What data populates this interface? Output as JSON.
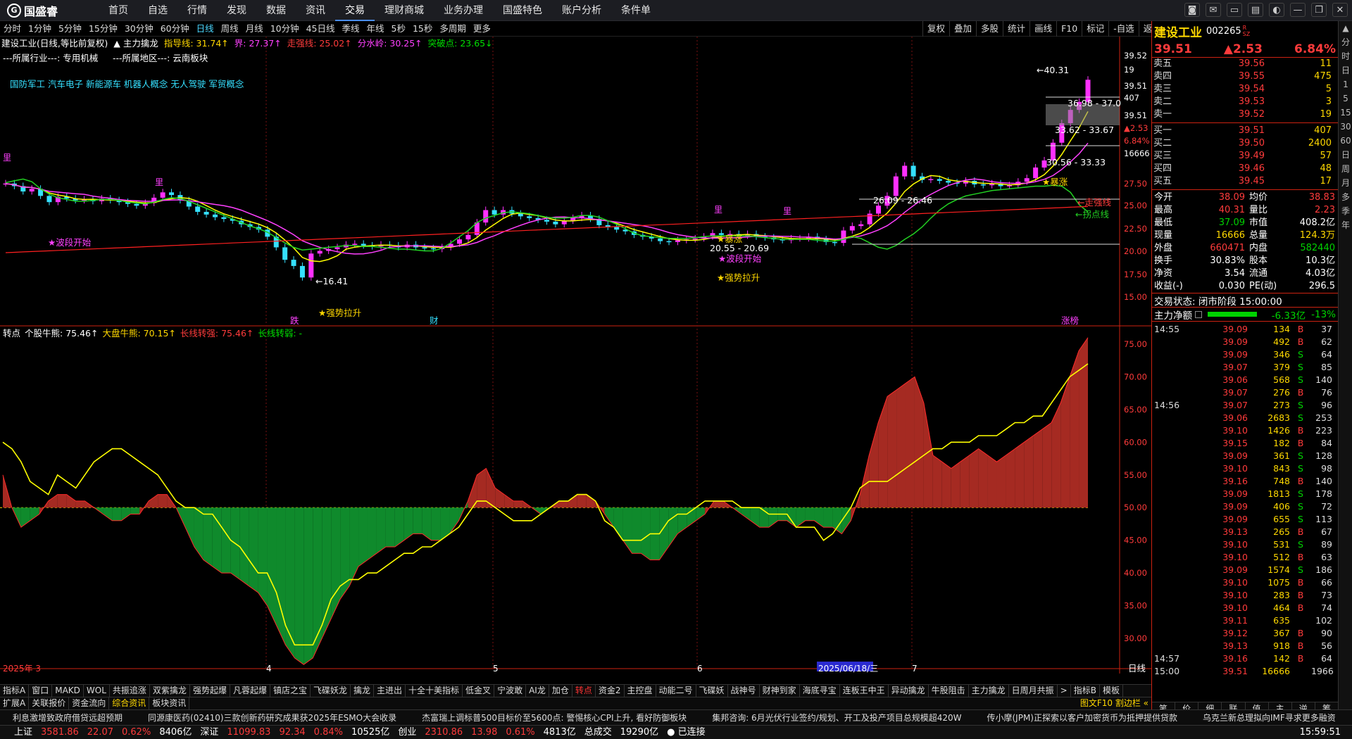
{
  "top": {
    "logo": "国盛睿",
    "menu": [
      "首页",
      "自选",
      "行情",
      "发现",
      "数据",
      "资讯",
      "交易",
      "理财商城",
      "业务办理",
      "国盛特色",
      "账户分析",
      "条件单"
    ],
    "active": 6
  },
  "periods": [
    "分时",
    "1分钟",
    "5分钟",
    "15分钟",
    "30分钟",
    "60分钟",
    "日线",
    "周线",
    "月线",
    "10分钟",
    "45日线",
    "季线",
    "年线",
    "5秒",
    "15秒",
    "多周期",
    "更多"
  ],
  "active_period": "日线",
  "tools": [
    "复权",
    "叠加",
    "多股",
    "统计",
    "画线",
    "F10",
    "标记",
    "-自选",
    "返回"
  ],
  "info": {
    "line1": [
      [
        "建设工业(日线,等比前复权)",
        "white"
      ],
      [
        "▲ 主力擒龙",
        "white"
      ],
      [
        "指导线: 31.74↑",
        "yellow"
      ],
      [
        "界: 27.37↑",
        "mag"
      ],
      [
        "走强线: 25.02↑",
        "red"
      ],
      [
        "分水岭: 30.25↑",
        "mag"
      ],
      [
        "突破点: 23.65↓",
        "green"
      ]
    ],
    "line2": "---所属行业---: 专用机械",
    "line3": "---所属地区---: 云南板块",
    "concepts": "国防军工 汽车电子 新能源车 机器人概念 无人驾驶 军贸概念"
  },
  "chart_data": {
    "type": "candlestick+indicator",
    "y_ticks": [
      "39.52",
      "19",
      "39.51",
      "407",
      "39.51",
      "▲2.53",
      "6.84%",
      "16666",
      "27.50",
      "25.00",
      "22.50",
      "20.00",
      "17.50",
      "15.00"
    ],
    "annotations": {
      "high": "←40.31",
      "low": "←16.41",
      "box1": "36.98 - 37.0",
      "box2": "33.62 - 33.67",
      "box3": "30.56 - 33.33",
      "box4": "26.09 - 26.46",
      "box5": "20.55 - 20.69",
      "lab1": "40.31",
      "bodong1": "★波段开始",
      "bodong2": "★波段开始",
      "qiang1": "★强势拉升",
      "qiang2": "★强势拉升",
      "meizhang1": "★暴涨",
      "meizhang2": "★暴涨",
      "zouqiang": "←走强线",
      "guaidian": "←拐点线",
      "die": "跌",
      "cai": "财",
      "zhangdie": "涨榜",
      "li": "里"
    },
    "ind_header": [
      [
        "转点",
        "white"
      ],
      [
        "个股牛熊: 75.46↑",
        "white"
      ],
      [
        "大盘牛熊: 70.15↑",
        "yellow"
      ],
      [
        "长线转强: 75.46↑",
        "red"
      ],
      [
        "长线转弱: -",
        "green"
      ]
    ],
    "ind_ticks": [
      "75.00",
      "70.00",
      "65.00",
      "60.00",
      "55.00",
      "50.00",
      "45.00",
      "40.00",
      "35.00",
      "30.00"
    ],
    "x_labels": [
      "2025年 3",
      "4",
      "5",
      "6",
      "2025/06/18/三",
      "7"
    ],
    "x_corner": "日线",
    "ind_values": [
      55,
      50,
      47,
      48,
      49,
      51,
      52,
      52,
      51,
      51,
      50,
      49,
      48,
      48,
      49,
      49,
      51,
      52,
      52,
      50,
      47,
      44,
      42,
      41,
      40,
      40,
      39,
      38,
      37,
      35,
      32,
      29,
      27,
      26,
      27,
      30,
      33,
      36,
      38,
      41,
      42,
      43,
      44,
      44,
      45,
      46,
      46,
      45,
      45,
      46,
      48,
      51,
      55,
      56,
      53,
      52,
      51,
      51,
      50,
      49,
      50,
      51,
      51,
      52,
      52,
      51,
      49,
      47,
      45,
      43,
      43,
      42,
      42,
      44,
      46,
      47,
      48,
      49,
      51,
      51,
      50,
      49,
      48,
      47,
      47,
      48,
      48,
      47,
      48,
      48,
      47,
      47,
      46,
      48,
      52,
      58,
      63,
      67,
      68,
      69,
      70,
      66,
      58,
      57,
      56,
      57,
      58,
      59,
      58,
      57,
      58,
      59,
      60,
      61,
      62,
      63,
      66,
      70,
      74,
      76
    ],
    "ind_line": [
      60,
      59,
      57,
      54,
      53,
      52,
      55,
      54,
      53,
      55,
      57,
      58,
      59,
      59,
      58,
      57,
      56,
      55,
      53,
      51,
      50,
      50,
      49,
      49,
      47,
      45,
      44,
      42,
      40,
      40,
      37,
      32,
      29,
      29,
      29,
      32,
      36,
      38,
      39,
      39,
      40,
      40,
      41,
      42,
      43,
      43,
      44,
      44,
      45,
      46,
      47,
      49,
      51,
      51,
      50,
      49,
      48,
      48,
      48,
      49,
      50,
      51,
      51,
      52,
      52,
      51,
      48,
      47,
      45,
      45,
      45,
      46,
      46,
      48,
      49,
      49,
      50,
      51,
      51,
      51,
      51,
      50,
      50,
      50,
      49,
      49,
      49,
      47,
      47,
      47,
      45,
      46,
      48,
      50,
      53,
      54,
      54,
      54,
      55,
      56,
      57,
      58,
      59,
      59,
      60,
      60,
      60,
      61,
      61,
      61,
      62,
      63,
      63,
      64,
      64,
      66,
      68,
      70,
      71,
      72
    ]
  },
  "bottom_tabs": [
    "指标A",
    "窗口",
    "MAKD",
    "WOL",
    "共振追涨",
    "双紫擒龙",
    "强势起爆",
    "凡蓉起爆",
    "镇店之宝",
    "飞碟妖龙",
    "擒龙",
    "主进出",
    "十全十美指标",
    "低金叉",
    "宁波敢",
    "AI龙",
    "加仓",
    "转点",
    "资金2",
    "主控盘",
    "动能二号",
    "飞碟妖",
    "战神号",
    "财神到家",
    "海底寻宝",
    "连板王中王",
    "异动擒龙",
    "牛股阻击",
    "主力擒龙",
    "日周月共振",
    "指标B",
    "模板"
  ],
  "bottom_tabs_active": "转点",
  "bottom_tabs2": [
    "扩展A",
    "关联报价",
    "资金流向",
    "综合资讯",
    "板块资讯"
  ],
  "bottom_tabs2_right": "图文F10  割边栏 «",
  "quote": {
    "name": "建设工业",
    "code": "002265",
    "badge": "R\nSZ",
    "price": "39.51",
    "change": "▲2.53",
    "pct": "6.84%",
    "asks": [
      [
        "卖五",
        "39.56",
        "11"
      ],
      [
        "卖四",
        "39.55",
        "475"
      ],
      [
        "卖三",
        "39.54",
        "5"
      ],
      [
        "卖二",
        "39.53",
        "3"
      ],
      [
        "卖一",
        "39.52",
        "19"
      ]
    ],
    "bids": [
      [
        "买一",
        "39.51",
        "407"
      ],
      [
        "买二",
        "39.50",
        "2400"
      ],
      [
        "买三",
        "39.49",
        "57"
      ],
      [
        "买四",
        "39.46",
        "48"
      ],
      [
        "买五",
        "39.45",
        "17"
      ]
    ],
    "stats": [
      [
        "今开",
        "38.09",
        "均价",
        "38.83"
      ],
      [
        "最高",
        "40.31",
        "量比",
        "2.23"
      ],
      [
        "最低",
        "37.09",
        "市值",
        "408.2亿"
      ],
      [
        "现量",
        "16666",
        "总量",
        "124.3万"
      ],
      [
        "外盘",
        "660471",
        "内盘",
        "582440"
      ],
      [
        "换手",
        "30.83%",
        "股本",
        "10.3亿"
      ],
      [
        "净资",
        "3.54",
        "流通",
        "4.03亿"
      ],
      [
        "收益(-)",
        "0.030",
        "PE(动)",
        "296.5"
      ]
    ],
    "trade_state": "交易状态: 闭市阶段 15:00:00",
    "zhuli": "主力净额",
    "zhuli_val": "-6.33亿",
    "zhuli_pct": "-13%",
    "ticks": [
      [
        "14:55",
        "39.09",
        "134",
        "B",
        "37"
      ],
      [
        "",
        "39.09",
        "492",
        "B",
        "62"
      ],
      [
        "",
        "39.09",
        "346",
        "S",
        "64"
      ],
      [
        "",
        "39.07",
        "379",
        "S",
        "85"
      ],
      [
        "",
        "39.06",
        "568",
        "S",
        "140"
      ],
      [
        "",
        "39.07",
        "276",
        "B",
        "76"
      ],
      [
        "14:56",
        "39.07",
        "273",
        "S",
        "96"
      ],
      [
        "",
        "39.06",
        "2683",
        "S",
        "253"
      ],
      [
        "",
        "39.10",
        "1426",
        "B",
        "223"
      ],
      [
        "",
        "39.15",
        "182",
        "B",
        "84"
      ],
      [
        "",
        "39.09",
        "361",
        "S",
        "128"
      ],
      [
        "",
        "39.10",
        "843",
        "S",
        "98"
      ],
      [
        "",
        "39.16",
        "748",
        "B",
        "140"
      ],
      [
        "",
        "39.09",
        "1813",
        "S",
        "178"
      ],
      [
        "",
        "39.09",
        "406",
        "S",
        "72"
      ],
      [
        "",
        "39.09",
        "655",
        "S",
        "113"
      ],
      [
        "",
        "39.13",
        "265",
        "B",
        "67"
      ],
      [
        "",
        "39.10",
        "531",
        "S",
        "89"
      ],
      [
        "",
        "39.10",
        "512",
        "B",
        "63"
      ],
      [
        "",
        "39.09",
        "1574",
        "S",
        "186"
      ],
      [
        "",
        "39.10",
        "1075",
        "B",
        "66"
      ],
      [
        "",
        "39.10",
        "283",
        "B",
        "73"
      ],
      [
        "",
        "39.10",
        "464",
        "B",
        "74"
      ],
      [
        "",
        "39.11",
        "635",
        "",
        "102"
      ],
      [
        "",
        "39.12",
        "367",
        "B",
        "90"
      ],
      [
        "",
        "39.13",
        "918",
        "B",
        "56"
      ],
      [
        "14:57",
        "39.16",
        "142",
        "B",
        "64"
      ],
      [
        "15:00",
        "39.51",
        "16666",
        "",
        "1966"
      ]
    ],
    "bottom_tabs": [
      "笔",
      "价",
      "细",
      "联",
      "值",
      "主",
      "逆",
      "筹"
    ]
  },
  "vtabs": [
    "分",
    "时",
    "日",
    "1",
    "5",
    "15",
    "30",
    "60",
    "日",
    "周",
    "月",
    "多",
    "季",
    "年"
  ],
  "news": [
    "利息激增致政府借贷远超预期",
    "同源康医药(02410)三款创新药研究成果获2025年ESMO大会收录",
    "杰富瑞上调标普500目标价至5600点: 警惕核心CPI上升, 看好防御板块",
    "集邦咨询: 6月光伏行业签约/规划、开工及投产项目总规模超420W",
    "传小摩(JPM)正探索以客户加密货币为抵押提供贷款",
    "乌克兰新总理拟向IMF寻求更多融资"
  ],
  "status": [
    [
      "上证",
      "white"
    ],
    [
      "3581.86",
      "red"
    ],
    [
      "22.07",
      "red"
    ],
    [
      "0.62%",
      "red"
    ],
    [
      "8406亿",
      "white"
    ],
    [
      "深证",
      "white"
    ],
    [
      "11099.83",
      "red"
    ],
    [
      "92.34",
      "red"
    ],
    [
      "0.84%",
      "red"
    ],
    [
      "10525亿",
      "white"
    ],
    [
      "创业",
      "white"
    ],
    [
      "2310.86",
      "red"
    ],
    [
      "13.98",
      "red"
    ],
    [
      "0.61%",
      "red"
    ],
    [
      "4813亿",
      "white"
    ],
    [
      "总成交",
      "white"
    ],
    [
      "19290亿",
      "white"
    ],
    [
      "● 已连接",
      "white"
    ]
  ],
  "clock": "15:59:51"
}
